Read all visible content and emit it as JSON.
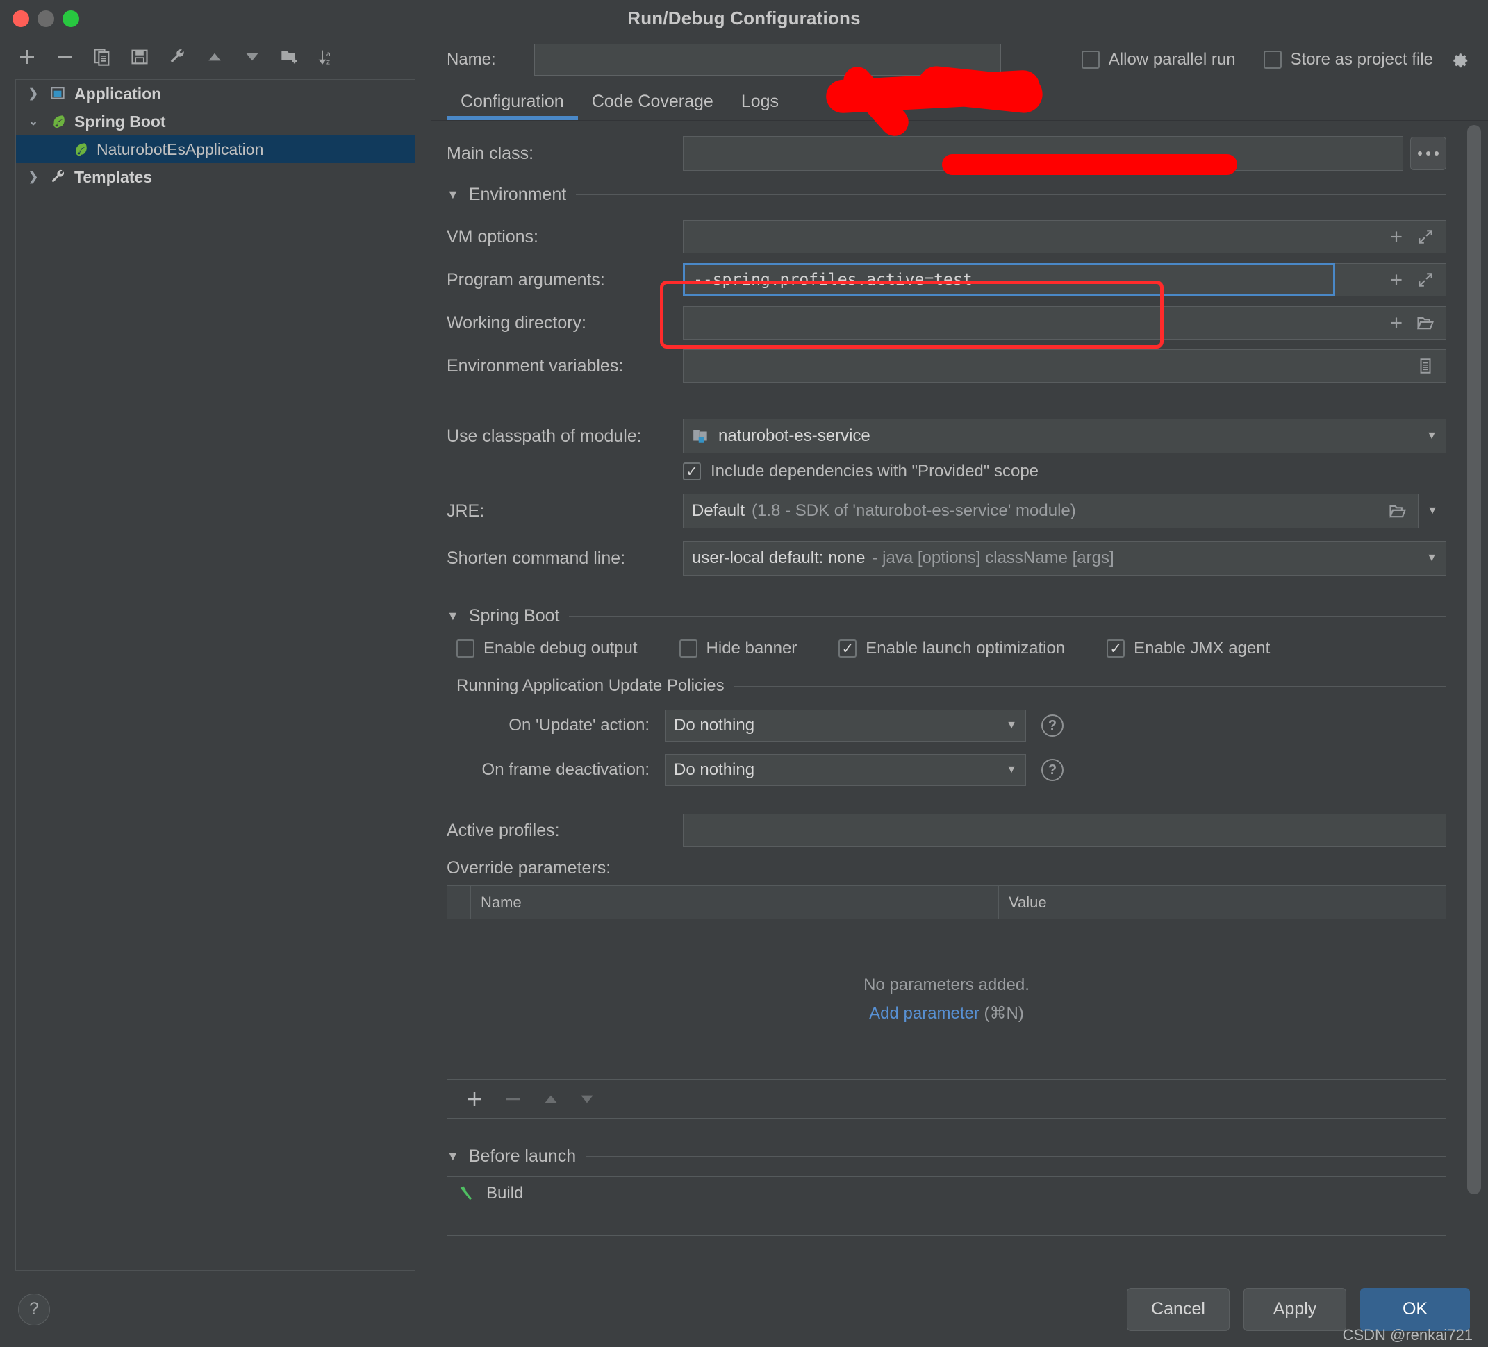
{
  "window": {
    "title": "Run/Debug Configurations",
    "watermark": "CSDN @renkai721"
  },
  "left_panel": {
    "toolbar": [
      {
        "name": "add-configuration-button",
        "glyph": "+"
      },
      {
        "name": "remove-configuration-button",
        "glyph": "−"
      },
      {
        "name": "copy-configuration-button",
        "glyph": "copy-icon"
      },
      {
        "name": "save-configuration-button",
        "glyph": "save-icon"
      },
      {
        "name": "edit-templates-button",
        "glyph": "wrench-icon"
      },
      {
        "name": "move-up-button",
        "glyph": "▲"
      },
      {
        "name": "move-down-button",
        "glyph": "▼"
      },
      {
        "name": "new-folder-button",
        "glyph": "folder-plus-icon"
      },
      {
        "name": "sort-configurations-button",
        "glyph": "sort-az-icon"
      }
    ],
    "tree": [
      {
        "label": "Application",
        "icon": "application-icon",
        "expanded": false,
        "selected": false,
        "level": 0,
        "bold": true
      },
      {
        "label": "Spring Boot",
        "icon": "spring-boot-icon",
        "expanded": true,
        "selected": false,
        "level": 0,
        "bold": true
      },
      {
        "label": "NaturobotEsApplication",
        "icon": "spring-boot-icon",
        "expanded": null,
        "selected": true,
        "level": 1,
        "bold": false
      },
      {
        "label": "Templates",
        "icon": "wrench-icon",
        "expanded": false,
        "selected": false,
        "level": 0,
        "bold": true
      }
    ]
  },
  "header": {
    "name_label": "Name:",
    "name_value": "",
    "allow_parallel_run": {
      "label": "Allow parallel run",
      "checked": false
    },
    "store_as_project_file": {
      "label": "Store as project file",
      "checked": false
    },
    "gear_icon": "gear-icon"
  },
  "tabs": [
    {
      "label": "Configuration",
      "active": true
    },
    {
      "label": "Code Coverage",
      "active": false
    },
    {
      "label": "Logs",
      "active": false
    }
  ],
  "form": {
    "main_class": {
      "label": "Main class:",
      "value": "",
      "browse_label": "..."
    },
    "environment_section": "Environment",
    "vm_options": {
      "label": "VM options:",
      "value": ""
    },
    "program_arguments": {
      "label": "Program arguments:",
      "value": "--spring.profiles.active=test"
    },
    "working_directory": {
      "label": "Working directory:",
      "value": ""
    },
    "environment_variables": {
      "label": "Environment variables:",
      "value": ""
    },
    "use_classpath_of_module": {
      "label": "Use classpath of module:",
      "value": "naturobot-es-service"
    },
    "include_provided_scope": {
      "label": "Include dependencies with \"Provided\" scope",
      "checked": true
    },
    "jre": {
      "label": "JRE:",
      "value": "Default",
      "value_hint": "(1.8 - SDK of 'naturobot-es-service' module)"
    },
    "shorten_command_line": {
      "label": "Shorten command line:",
      "value": "user-local default: none",
      "value_hint": "- java [options] className [args]"
    },
    "spring_boot_section": "Spring Boot",
    "spring_boot_checks": [
      {
        "label": "Enable debug output",
        "checked": false
      },
      {
        "label": "Hide banner",
        "checked": false
      },
      {
        "label": "Enable launch optimization",
        "checked": true
      },
      {
        "label": "Enable JMX agent",
        "checked": true
      }
    ],
    "update_policies_section": "Running Application Update Policies",
    "on_update_action": {
      "label": "On 'Update' action:",
      "value": "Do nothing"
    },
    "on_frame_deactivation": {
      "label": "On frame deactivation:",
      "value": "Do nothing"
    },
    "active_profiles": {
      "label": "Active profiles:",
      "value": ""
    },
    "override_parameters": {
      "label": "Override parameters:",
      "columns": [
        "Name",
        "Value"
      ],
      "empty_text": "No parameters added.",
      "add_link": "Add parameter",
      "add_shortcut": "(⌘N)",
      "rows": []
    },
    "before_launch_section": "Before launch",
    "before_launch_items": [
      {
        "label": "Build",
        "icon": "build-hammer-icon"
      }
    ]
  },
  "footer": {
    "help_label": "?",
    "cancel_label": "Cancel",
    "apply_label": "Apply",
    "ok_label": "OK"
  },
  "colors": {
    "accent": "#4a88c7",
    "primary_button": "#35628f",
    "selection": "#113a5c",
    "redaction": "#ff0000",
    "link": "#5891d4"
  }
}
